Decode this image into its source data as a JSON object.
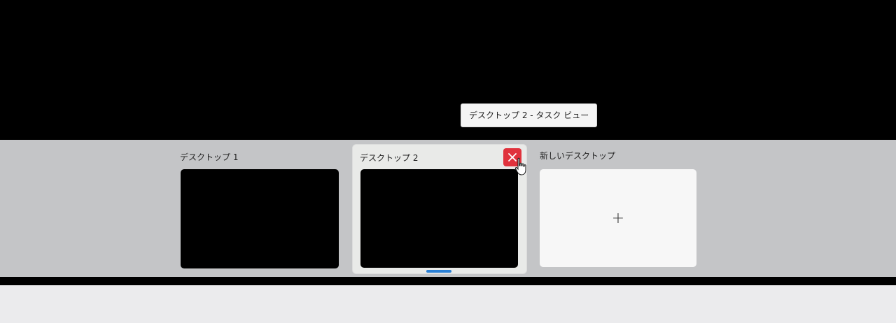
{
  "tooltip": {
    "text": "デスクトップ 2 - タスク ビュー"
  },
  "desktops": [
    {
      "label": "デスクトップ 1",
      "active": false
    },
    {
      "label": "デスクトップ 2",
      "active": true
    }
  ],
  "new_desktop": {
    "label": "新しいデスクトップ",
    "icon": "plus-icon",
    "symbol": "+"
  },
  "close_button": {
    "icon": "close-icon"
  },
  "colors": {
    "desktop_bar_background": "#c4c5c7",
    "active_tile_background": "#e9eae8",
    "close_button_background": "#e0323c",
    "active_indicator": "#2a7fd4",
    "taskbar_background": "#ebebed"
  }
}
